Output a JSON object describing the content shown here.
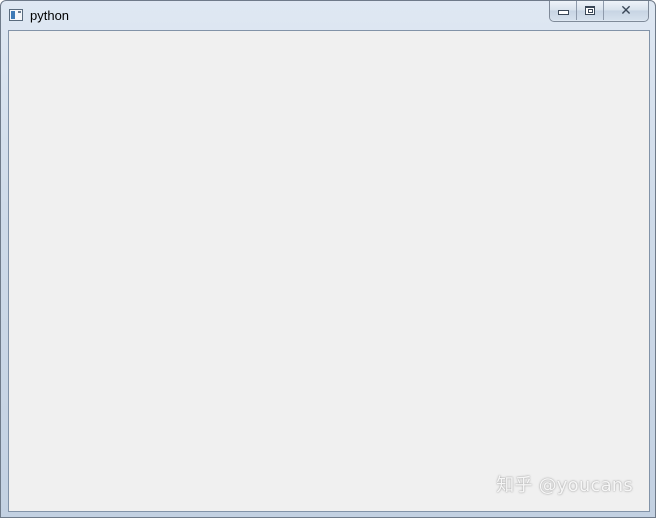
{
  "window": {
    "title": "python",
    "app_icon": "window-app-icon",
    "controls": {
      "minimize_icon": "minimize-icon",
      "maximize_icon": "maximize-icon",
      "close_icon": "close-icon",
      "close_glyph": "✕"
    }
  },
  "client_area": {
    "background": "#f0f0f0"
  },
  "watermark": {
    "text": "知乎 @youcans"
  }
}
